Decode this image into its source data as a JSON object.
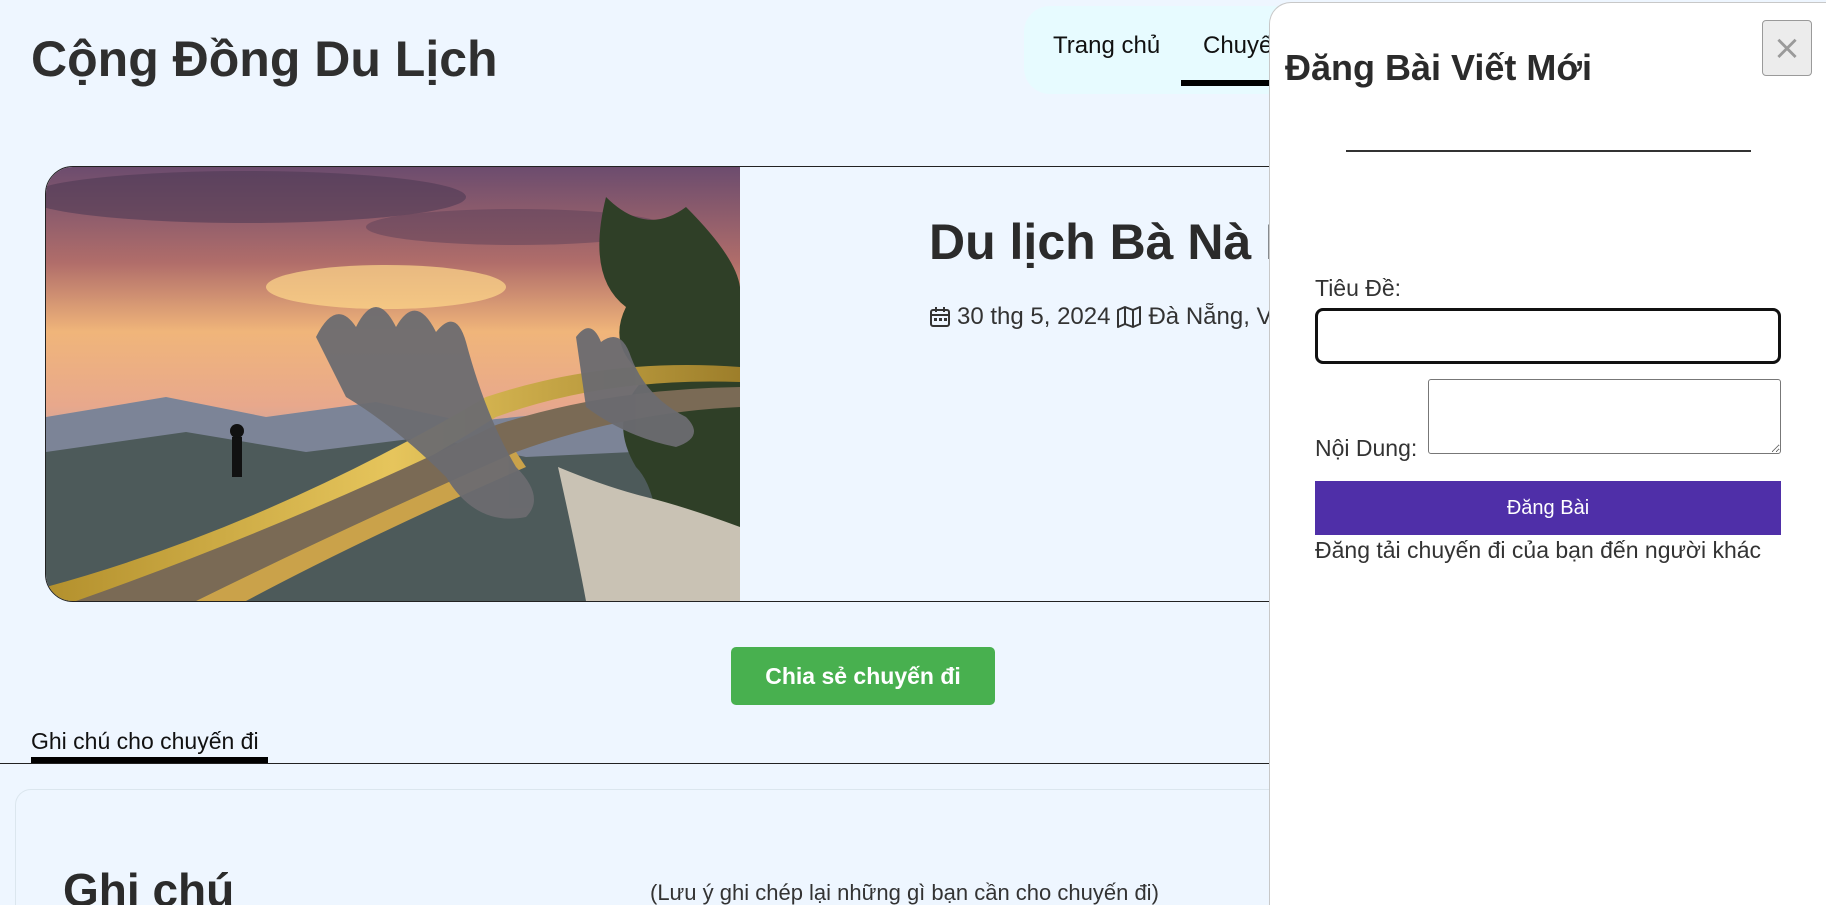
{
  "header": {
    "site_title": "Cộng Đồng Du Lịch",
    "nav": {
      "home_label": "Trang chủ",
      "trips_label": "Chuyế"
    }
  },
  "trip": {
    "title": "Du lịch Bà Nà H",
    "date": "30 thg 5, 2024",
    "location": "Đà Nẵng, V",
    "image_icon": "golden-bridge-photo"
  },
  "actions": {
    "share_label": "Chia sẻ chuyến đi"
  },
  "notes": {
    "tab_label": "Ghi chú cho chuyến đi",
    "heading": "Ghi chú",
    "hint": "(Lưu ý ghi chép lại những gì bạn cần cho chuyến đi)"
  },
  "modal": {
    "title": "Đăng Bài Viết Mới",
    "close_icon": "×",
    "title_label": "Tiêu Đề:",
    "title_value": "",
    "content_label": "Nội Dung:",
    "content_value": "",
    "submit_label": "Đăng Bài",
    "hint": "Đăng tải chuyến đi của bạn đến người khác"
  },
  "colors": {
    "page_bg": "#eef6ff",
    "share_button": "#48b04f",
    "submit_button": "#4f2fa8",
    "nav_bg": "#e7fbff"
  }
}
